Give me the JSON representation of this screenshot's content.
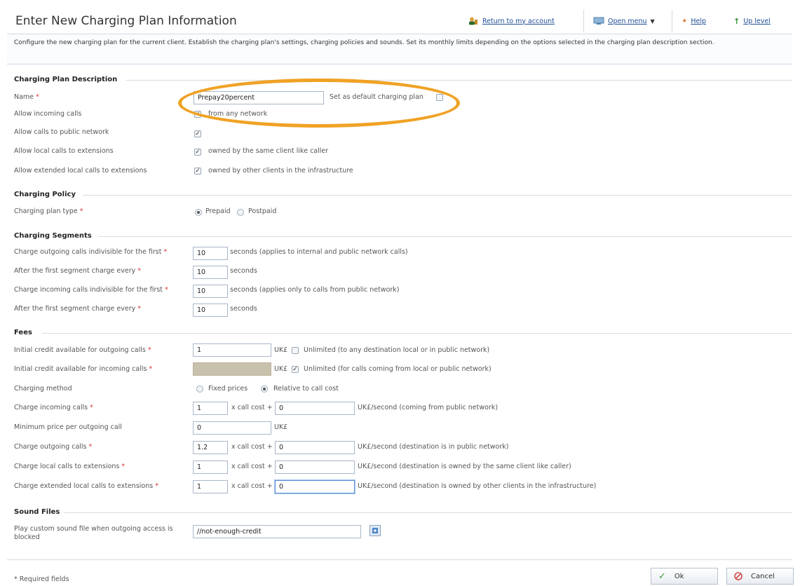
{
  "page": {
    "title": "Enter New Charging Plan Information",
    "description": "Configure the new charging plan for the current client. Establish the charging plan's settings, charging policies and sounds. Set its monthly limits depending on the options selected in the charging plan description section."
  },
  "nav": {
    "return_label": "Return to my account",
    "open_menu_label": "Open menu",
    "help_label": "Help",
    "up_level_label": "Up level"
  },
  "sections": {
    "description": "Charging Plan Description",
    "policy": "Charging Policy",
    "segments": "Charging Segments",
    "fees": "Fees",
    "sounds": "Sound Files"
  },
  "desc": {
    "name_label": "Name",
    "name_value": "Prepay20percent",
    "default_label": "Set as default charging plan",
    "incoming_label": "Allow incoming calls",
    "incoming_text": "from any network",
    "public_label": "Allow calls to public network",
    "local_label": "Allow local calls to extensions",
    "local_text": "owned by the same client like caller",
    "extended_label": "Allow extended local calls to extensions",
    "extended_text": "owned by other clients in the infrastructure"
  },
  "policy": {
    "type_label": "Charging plan type",
    "prepaid": "Prepaid",
    "postpaid": "Postpaid"
  },
  "segments": {
    "out_first_label": "Charge outgoing calls indivisible for the first",
    "out_first_value": "10",
    "out_first_note": "seconds (applies to internal and public network calls)",
    "out_every_label": "After the first segment charge every",
    "out_every_value": "10",
    "out_every_note": "seconds",
    "in_first_label": "Charge incoming calls indivisible for the first",
    "in_first_value": "10",
    "in_first_note": "seconds (applies only to calls from public network)",
    "in_every_label": "After the first segment charge every",
    "in_every_value": "10",
    "in_every_note": "seconds"
  },
  "fees": {
    "credit_out_label": "Initial credit available for outgoing calls",
    "credit_out_value": "1",
    "credit_out_unit": "UK£",
    "credit_out_unlimited": "Unlimited (to any destination local or in public network)",
    "credit_in_label": "Initial credit available for incoming calls",
    "credit_in_unit": "UK£",
    "credit_in_unlimited": "Unlimited (for calls coming from local or public network)",
    "method_label": "Charging method",
    "method_fixed": "Fixed prices",
    "method_relative": "Relative to call cost",
    "in_calls_label": "Charge incoming calls",
    "in_calls_mult": "1",
    "in_calls_add": "0",
    "in_calls_note": "UK£/second (coming from public network)",
    "min_price_label": "Minimum price per outgoing call",
    "min_price_value": "0",
    "min_price_unit": "UK£",
    "out_calls_label": "Charge outgoing calls",
    "out_calls_mult": "1.2",
    "out_calls_add": "0",
    "out_calls_note": "UK£/second (destination is in public network)",
    "local_calls_label": "Charge local calls to extensions",
    "local_calls_mult": "1",
    "local_calls_add": "0",
    "local_calls_note": "UK£/second (destination is owned by the same client like caller)",
    "ext_calls_label": "Charge extended local calls to extensions",
    "ext_calls_mult": "1",
    "ext_calls_add": "0",
    "ext_calls_note": "UK£/second (destination is owned by other clients in the infrastructure)",
    "x_call_cost": "x call cost +"
  },
  "sounds": {
    "play_label": "Play custom sound file when outgoing access is blocked",
    "file_value": "//not-enough-credit"
  },
  "footer": {
    "required_note": "* Required fields",
    "ok_label": "Ok",
    "cancel_label": "Cancel"
  },
  "required_mark": "*",
  "colors": {
    "accent": "#1f4e99",
    "highlight_oval": "#f0a225",
    "required": "#d33333"
  }
}
